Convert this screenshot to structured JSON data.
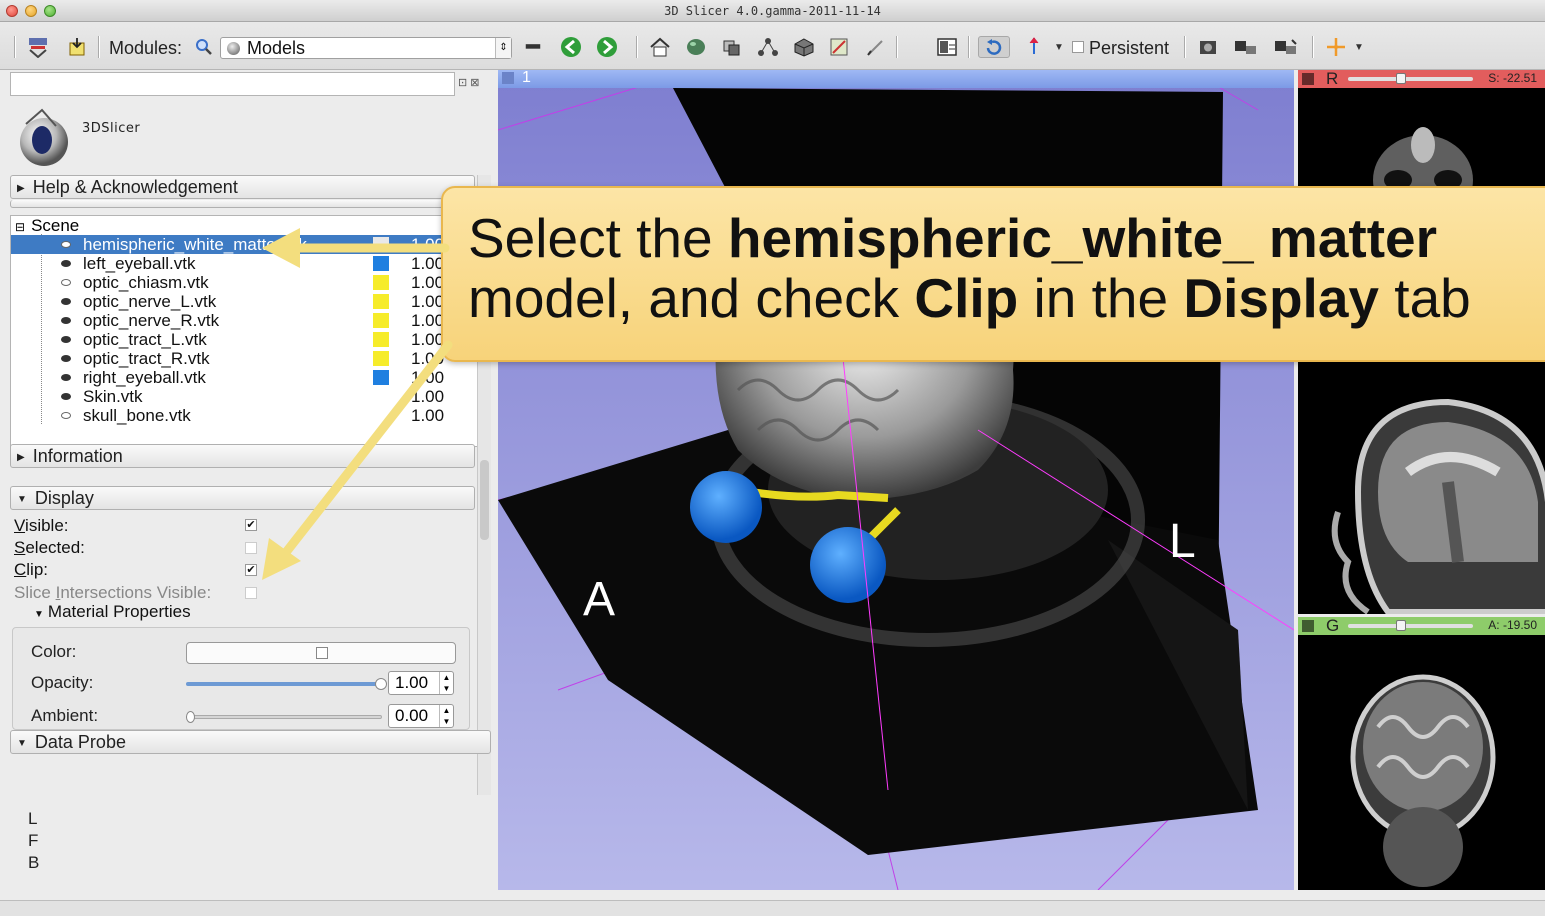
{
  "window": {
    "title": "3D Slicer 4.0.gamma-2011-11-14"
  },
  "toolbar": {
    "modules_label": "Modules:",
    "module_selected": "Models",
    "persistent_label": "Persistent"
  },
  "logo": {
    "text": "3DSlicer"
  },
  "sections": {
    "help": "Help & Acknowledgement",
    "information": "Information",
    "display": "Display",
    "material": "Material Properties",
    "data_probe": "Data Probe"
  },
  "scene": {
    "root": "Scene",
    "items": [
      {
        "name": "hemispheric_white_matter.vtk",
        "color": "#e8e8e8",
        "opacity": "1.00",
        "visible": false,
        "selected": true
      },
      {
        "name": "left_eyeball.vtk",
        "color": "#1f7fe0",
        "opacity": "1.00",
        "visible": true
      },
      {
        "name": "optic_chiasm.vtk",
        "color": "#f6ec2a",
        "opacity": "1.00",
        "visible": false
      },
      {
        "name": "optic_nerve_L.vtk",
        "color": "#f6ec2a",
        "opacity": "1.00",
        "visible": true
      },
      {
        "name": "optic_nerve_R.vtk",
        "color": "#f6ec2a",
        "opacity": "1.00",
        "visible": true
      },
      {
        "name": "optic_tract_L.vtk",
        "color": "#f6ec2a",
        "opacity": "1.00",
        "visible": true
      },
      {
        "name": "optic_tract_R.vtk",
        "color": "#f6ec2a",
        "opacity": "1.00",
        "visible": true
      },
      {
        "name": "right_eyeball.vtk",
        "color": "#1f7fe0",
        "opacity": "1.00",
        "visible": true
      },
      {
        "name": "Skin.vtk",
        "color": "",
        "opacity": "1.00",
        "visible": true
      },
      {
        "name": "skull_bone.vtk",
        "color": "",
        "opacity": "1.00",
        "visible": false
      }
    ]
  },
  "display": {
    "visible_label": "isible:",
    "visible_prefix": "V",
    "selected_label": "elected:",
    "selected_prefix": "S",
    "clip_label": "lip:",
    "clip_prefix": "C",
    "slice_label_a": "Slice ",
    "slice_label_u": "I",
    "slice_label_b": "ntersections Visible:",
    "visible_checked": "✔",
    "clip_checked": "✔"
  },
  "material": {
    "color_label": "Color:",
    "opacity_label": "Opacity:",
    "opacity_value": "1.00",
    "ambient_label": "Ambient:",
    "ambient_value": "0.00"
  },
  "data_probe": {
    "lines": [
      "L",
      "F",
      "B"
    ]
  },
  "view3d": {
    "label": "1",
    "anterior": "A",
    "left": "L"
  },
  "slices": {
    "red": {
      "name": "R",
      "offset": "S: -22.51",
      "color": "#e25d5d"
    },
    "green": {
      "name": "G",
      "offset": "A: -19.50",
      "color": "#8ecc6a"
    }
  },
  "callout": {
    "line1_a": "Select the ",
    "line1_b": "hemispheric_white_ matter",
    "line2_a": "model, and check ",
    "line2_b": "Clip",
    "line2_c": " in the ",
    "line2_d": "Display",
    "line2_e": " tab"
  }
}
